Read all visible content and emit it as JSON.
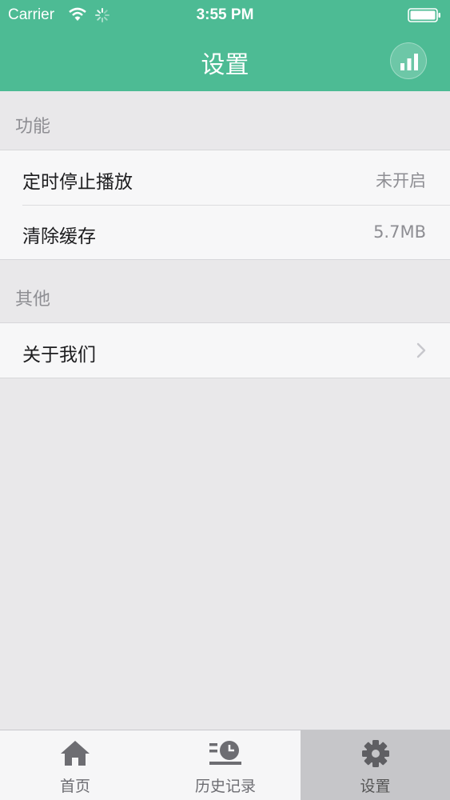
{
  "status_bar": {
    "carrier": "Carrier",
    "time": "3:55 PM"
  },
  "nav": {
    "title": "设置"
  },
  "sections": {
    "function": {
      "title": "功能",
      "rows": [
        {
          "label": "定时停止播放",
          "value": "未开启"
        },
        {
          "label": "清除缓存",
          "value": "5.7MB"
        }
      ]
    },
    "other": {
      "title": "其他",
      "rows": [
        {
          "label": "关于我们"
        }
      ]
    }
  },
  "tabbar": {
    "items": [
      {
        "label": "首页",
        "icon": "home-icon"
      },
      {
        "label": "历史记录",
        "icon": "history-icon"
      },
      {
        "label": "设置",
        "icon": "gear-icon",
        "active": true
      }
    ]
  },
  "colors": {
    "header": "#4dbb94",
    "background": "#e9e8ea",
    "active_tab": "#c6c6c9"
  }
}
